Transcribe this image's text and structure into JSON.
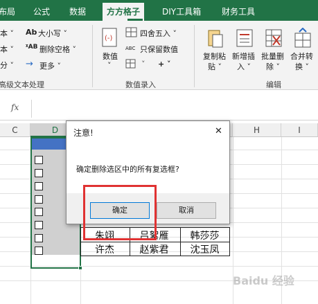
{
  "tabs": [
    "布局",
    "公式",
    "数据",
    "方方格子",
    "DIY工具箱",
    "财务工具"
  ],
  "ribbon": {
    "left": {
      "items": [
        "本 ˅",
        "本 ˅",
        "分 ˅"
      ],
      "group_label": "高级文本处理"
    },
    "text_group": {
      "case_label": "大小写 ˅",
      "remove_space_label": "删除空格 ˅",
      "more_label": "更多 ˅"
    },
    "num_group": {
      "numeric_label": "数值",
      "numeric_arrow": "˅",
      "round_label": "四舍五入 ˅",
      "keep_num_label": "只保留数值",
      "plus_label": "+ ˅",
      "group_label": "数值录入"
    },
    "edit_group": {
      "buttons": [
        {
          "line1": "复制粘",
          "line2": "贴 ˅"
        },
        {
          "line1": "新增插",
          "line2": "入 ˅"
        },
        {
          "line1": "批量删",
          "line2": "除 ˅"
        },
        {
          "line1": "合并转",
          "line2": "换 ˅"
        }
      ],
      "group_label": "编辑"
    }
  },
  "formula_bar": {
    "fx": "fx"
  },
  "columns": [
    "C",
    "D",
    "H",
    "I"
  ],
  "cells": [
    [
      "朱翊",
      "吕絮雁",
      "韩莎莎"
    ],
    [
      "许杰",
      "赵紫君",
      "沈玉凤"
    ]
  ],
  "dialog": {
    "title": "注意!",
    "close": "✕",
    "message": "确定删除选区中的所有复选框?",
    "ok_label": "确定",
    "cancel_label": "取消"
  },
  "watermark": "Baidu 经验"
}
